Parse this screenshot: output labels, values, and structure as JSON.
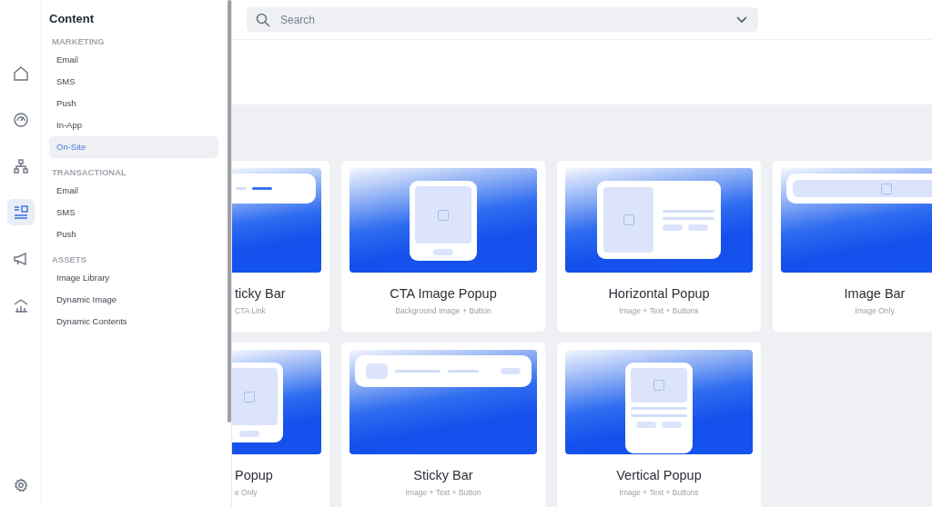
{
  "rail": {
    "items": [
      {
        "selected": false
      },
      {
        "selected": false
      },
      {
        "selected": false
      },
      {
        "selected": true
      },
      {
        "selected": false
      },
      {
        "selected": false
      }
    ]
  },
  "panel": {
    "title": "Content",
    "sections": [
      {
        "heading": "MARKETING",
        "items": [
          {
            "label": "Email",
            "selected": false
          },
          {
            "label": "SMS",
            "selected": false
          },
          {
            "label": "Push",
            "selected": false
          },
          {
            "label": "In-App",
            "selected": false
          },
          {
            "label": "On-Site",
            "selected": true
          }
        ]
      },
      {
        "heading": "TRANSACTIONAL",
        "items": [
          {
            "label": "Email",
            "selected": false
          },
          {
            "label": "SMS",
            "selected": false
          },
          {
            "label": "Push",
            "selected": false
          }
        ]
      },
      {
        "heading": "ASSETS",
        "items": [
          {
            "label": "Image Library",
            "selected": false
          },
          {
            "label": "Dynamic Image",
            "selected": false
          },
          {
            "label": "Dynamic Contents",
            "selected": false
          }
        ]
      }
    ]
  },
  "search": {
    "placeholder": "Search"
  },
  "cards": [
    {
      "kind": "sticky",
      "title": "ticky Bar",
      "subtitle": "CTA Link"
    },
    {
      "kind": "tall",
      "title": "CTA Image Popup",
      "subtitle": "Background Image + Button"
    },
    {
      "kind": "horizontal",
      "title": "Horizontal Popup",
      "subtitle": "Image + Text + Buttons"
    },
    {
      "kind": "imagebar",
      "title": "Image Bar",
      "subtitle": "Image Only"
    },
    {
      "kind": "tall",
      "title": "Popup",
      "subtitle": "e Only"
    },
    {
      "kind": "stickyfull",
      "title": "Sticky Bar",
      "subtitle": "Image + Text + Button"
    },
    {
      "kind": "vertical",
      "title": "Vertical Popup",
      "subtitle": "Image + Text + Buttons"
    }
  ]
}
